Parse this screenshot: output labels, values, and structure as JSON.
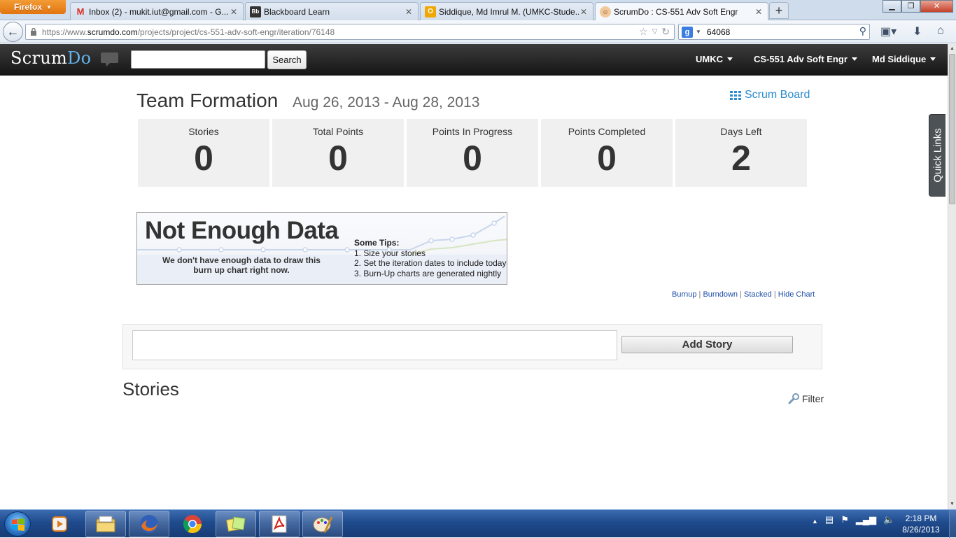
{
  "browser": {
    "menu_label": "Firefox",
    "tabs": [
      {
        "title": "Inbox (2) - mukit.iut@gmail.com - G...",
        "icon": "gmail-icon"
      },
      {
        "title": "Blackboard Learn",
        "icon": "blackboard-icon"
      },
      {
        "title": "Siddique, Md Imrul M. (UMKC-Stude...",
        "icon": "outlook-icon"
      },
      {
        "title": "ScrumDo : CS-551 Adv Soft Engr",
        "icon": "scrumdo-icon",
        "active": true
      }
    ],
    "new_tab_label": "+",
    "url_prefix": "https://www.",
    "url_host": "scrumdo.com",
    "url_path": "/projects/project/cs-551-adv-soft-engr/iteration/76148",
    "search_value": "64068",
    "search_engine_icon": "google-icon"
  },
  "header": {
    "logo_scrum": "Scrum",
    "logo_do": "Do",
    "search_placeholder": "",
    "search_button": "Search",
    "menus": [
      "UMKC",
      "CS-551 Adv Soft Engr",
      "Md Siddique"
    ]
  },
  "iteration": {
    "title": "Team Formation",
    "dates": "Aug 26, 2013 - Aug 28, 2013",
    "scrum_board_link": "Scrum Board"
  },
  "stats": [
    {
      "label": "Stories",
      "value": "0"
    },
    {
      "label": "Total Points",
      "value": "0"
    },
    {
      "label": "Points In Progress",
      "value": "0"
    },
    {
      "label": "Points Completed",
      "value": "0"
    },
    {
      "label": "Days Left",
      "value": "2"
    }
  ],
  "no_data": {
    "heading": "Not Enough Data",
    "message_line1": "We don't have enough data to draw this",
    "message_line2": "burn up chart right now.",
    "tips_title": "Some Tips:",
    "tips": [
      "1. Size your stories",
      "2. Set the iteration dates to include today",
      "3. Burn-Up charts are generated nightly"
    ]
  },
  "chart_links": [
    "Burnup",
    "Burndown",
    "Stacked",
    "Hide Chart"
  ],
  "chart_links_separator": "|",
  "add_story": {
    "input_value": "",
    "button_label": "Add Story"
  },
  "stories": {
    "heading": "Stories",
    "filter_label": "Filter"
  },
  "quick_links_label": "Quick Links",
  "taskbar": {
    "time": "2:18 PM",
    "date": "8/26/2013",
    "pinned_apps": [
      "media-player-icon",
      "explorer-icon",
      "firefox-icon",
      "chrome-icon",
      "sticky-notes-icon",
      "acrobat-icon",
      "paint-icon"
    ]
  },
  "colors": {
    "scrumdo_blue": "#63b2ec",
    "link_blue": "#2a8bd0",
    "header_dark": "#1e1e1e",
    "stat_bg": "#f0f0f0",
    "firefox_orange": "#e2750f"
  }
}
